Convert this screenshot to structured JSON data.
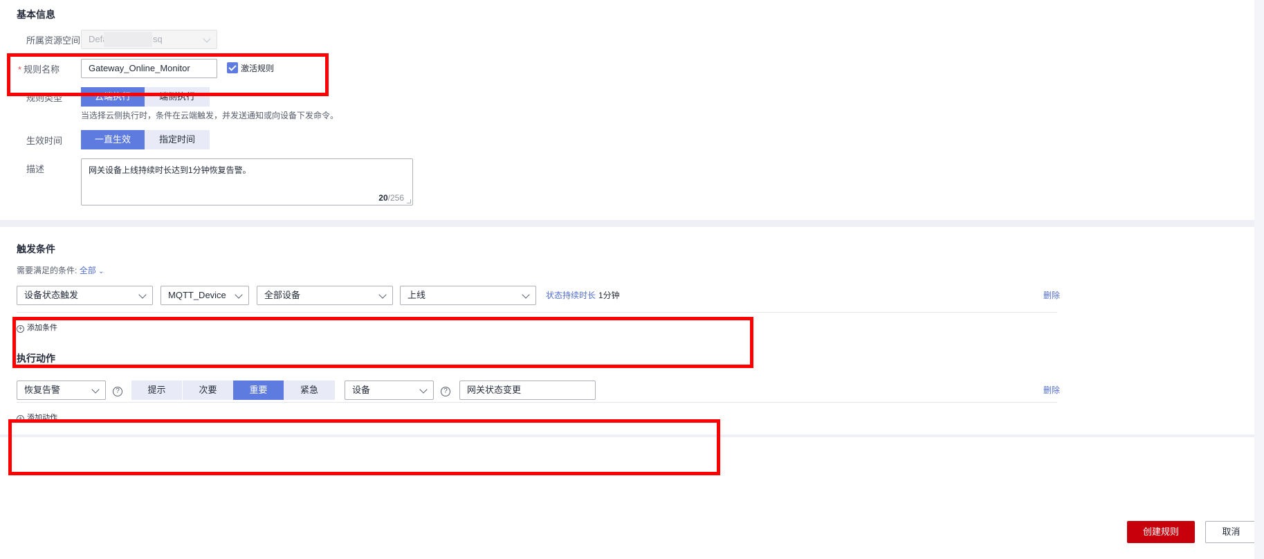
{
  "basic": {
    "title": "基本信息",
    "resource_space": {
      "label": "所属资源空间",
      "value_prefix": "Defa",
      "value_suffix": "sq"
    },
    "rule_name": {
      "label": "规则名称",
      "value": "Gateway_Online_Monitor"
    },
    "activate": {
      "label": "激活规则",
      "checked": true
    },
    "rule_type": {
      "label": "规则类型",
      "options": [
        "云端执行",
        "端侧执行"
      ],
      "selected": 0,
      "hint": "当选择云侧执行时，条件在云端触发，并发送通知或向设备下发命令。"
    },
    "effective_time": {
      "label": "生效时间",
      "options": [
        "一直生效",
        "指定时间"
      ],
      "selected": 0
    },
    "description": {
      "label": "描述",
      "value": "网关设备上线持续时长达到1分钟恢复告警。",
      "count": "20",
      "max": "/256"
    }
  },
  "trigger": {
    "title": "触发条件",
    "match_label": "需要满足的条件:",
    "match_value": "全部",
    "condition": {
      "type": "设备状态触发",
      "product": "MQTT_Device",
      "device_scope": "全部设备",
      "status": "上线",
      "duration_link": "状态持续时长",
      "duration_value": "1分钟"
    },
    "delete": "删除",
    "add": "添加条件"
  },
  "action": {
    "title": "执行动作",
    "type": "恢复告警",
    "severity": {
      "options": [
        "提示",
        "次要",
        "重要",
        "紧急"
      ],
      "selected": 2
    },
    "target": "设备",
    "alarm_name": "网关状态变更",
    "delete": "删除",
    "add": "添加动作"
  },
  "footer": {
    "create": "创建规则",
    "cancel": "取消"
  },
  "colors": {
    "accent": "#5e7ce0",
    "primary_button": "#c7000b",
    "highlight_box": "#ff0000"
  }
}
